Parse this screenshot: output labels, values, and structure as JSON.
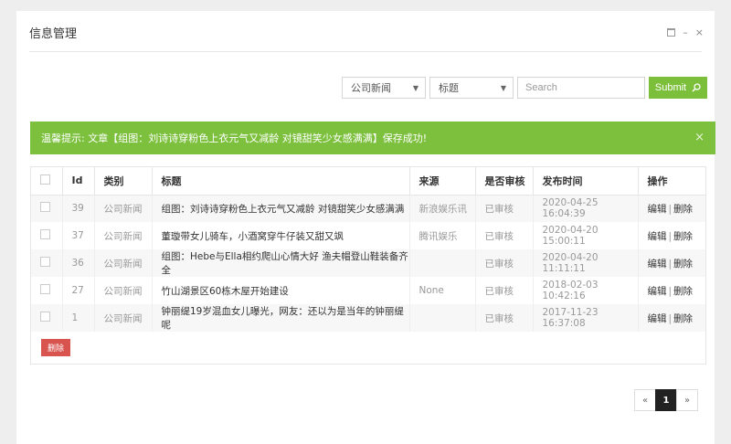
{
  "header": {
    "title": "信息管理",
    "controls": [
      "rect-icon",
      "minimize-icon",
      "close-icon"
    ],
    "minimize_glyph": "–",
    "close_glyph": "×"
  },
  "search": {
    "category_value": "公司新闻",
    "field_value": "标题",
    "placeholder": "Search",
    "submit_label": "Submit"
  },
  "alert": {
    "text": "温馨提示: 文章【组图：刘诗诗穿粉色上衣元气又减龄 对镜甜笑少女感满满】保存成功!",
    "close_glyph": "×",
    "color": "#7cc03d"
  },
  "table": {
    "columns": [
      "",
      "Id",
      "类别",
      "标题",
      "来源",
      "是否审核",
      "发布时间",
      "操作"
    ],
    "rows": [
      {
        "id": "39",
        "category": "公司新闻",
        "title": "组图：刘诗诗穿粉色上衣元气又减龄 对镜甜笑少女感满满",
        "source": "新浪娱乐讯",
        "status": "已审核",
        "time": "2020-04-25 16:04:39"
      },
      {
        "id": "37",
        "category": "公司新闻",
        "title": "董璇带女儿骑车，小酒窝穿牛仔装又甜又飒",
        "source": "腾讯娱乐",
        "status": "已审核",
        "time": "2020-04-20 15:00:11"
      },
      {
        "id": "36",
        "category": "公司新闻",
        "title": "组图：Hebe与Ella相约爬山心情大好 渔夫帽登山鞋装备齐全",
        "source": "",
        "status": "已审核",
        "time": "2020-04-20 11:11:11"
      },
      {
        "id": "27",
        "category": "公司新闻",
        "title": "竹山湖景区60栋木屋开始建设",
        "source": "None",
        "status": "已审核",
        "time": "2018-02-03 10:42:16"
      },
      {
        "id": "1",
        "category": "公司新闻",
        "title": "钟丽缇19岁混血女儿曝光，网友：还以为是当年的钟丽缇呢",
        "source": "",
        "status": "已审核",
        "time": "2017-11-23 16:37:08"
      }
    ],
    "edit_label": "编辑",
    "separator": "|",
    "delete_label": "删除",
    "bulk_delete_label": "删除"
  },
  "pagination": {
    "prev": "«",
    "current": "1",
    "next": "»"
  },
  "colors": {
    "accent": "#7cbf3a",
    "danger": "#d9534f"
  }
}
